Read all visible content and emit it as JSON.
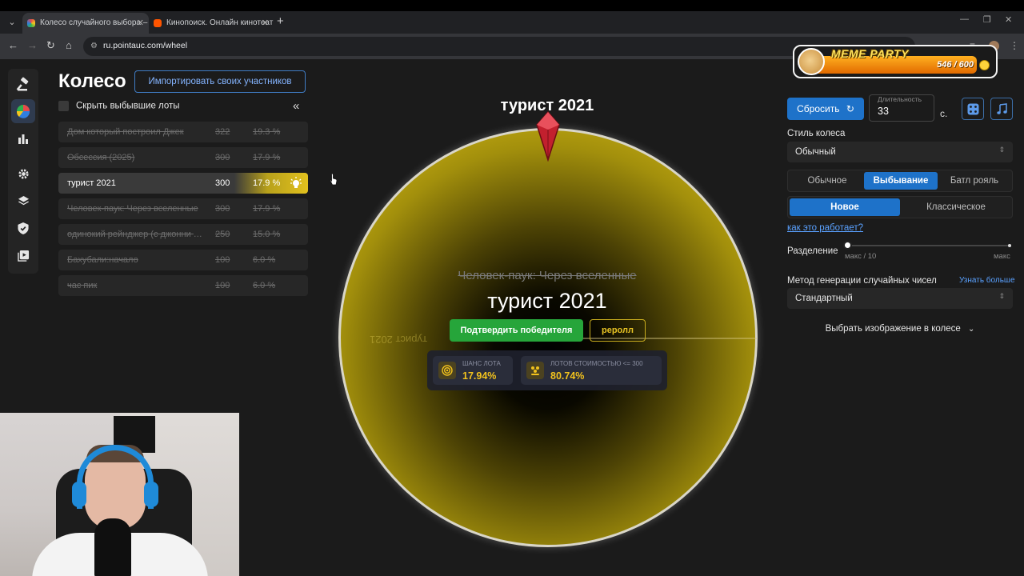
{
  "browser": {
    "tabs": [
      {
        "title": "Колесо случайного выбора – П",
        "active": true
      },
      {
        "title": "Кинопоиск. Онлайн кинотеатр",
        "active": false
      }
    ],
    "url": "ru.pointauc.com/wheel"
  },
  "header": {
    "title": "Колесо",
    "import_label": "Импортировать своих участников"
  },
  "filters": {
    "hide_eliminated_label": "Скрыть выбывшие лоты"
  },
  "lots": [
    {
      "name": "Дом который построил Джек",
      "amount": "322",
      "percent": "19.3 %",
      "eliminated": true
    },
    {
      "name": "Обсессия (2025)",
      "amount": "300",
      "percent": "17.9 %",
      "eliminated": true
    },
    {
      "name": "турист 2021",
      "amount": "300",
      "percent": "17.9 %",
      "eliminated": false
    },
    {
      "name": "Человек-паук: Через вселенные",
      "amount": "300",
      "percent": "17.9 %",
      "eliminated": true
    },
    {
      "name": "одинокий рейнджер (с джонни депом)",
      "amount": "250",
      "percent": "15.0 %",
      "eliminated": true
    },
    {
      "name": "Бахубали:начало",
      "amount": "100",
      "percent": "6.0 %",
      "eliminated": true
    },
    {
      "name": "час пик",
      "amount": "100",
      "percent": "6.0 %",
      "eliminated": true
    }
  ],
  "wheel": {
    "title": "турист 2021",
    "mirrored_label": "турист 2021",
    "previous_winner": "Человек-паук: Через вселенные",
    "winner": "турист 2021",
    "confirm_label": "Подтвердить победителя",
    "reroll_label": "реролл",
    "stats": [
      {
        "label": "ШАНС ЛОТА",
        "value": "17.94%"
      },
      {
        "label": "ЛОТОВ СТОИМОСТЬЮ <= 300",
        "value": "80.74%"
      }
    ],
    "color": "#c6ad12"
  },
  "controls": {
    "reset_label": "Сбросить",
    "duration_label": "Длительность",
    "duration_value": "33",
    "duration_unit": "с.",
    "wheel_style_label": "Стиль колеса",
    "wheel_style_value": "Обычный",
    "modes": [
      "Обычное",
      "Выбывание",
      "Батл рояль"
    ],
    "active_mode": "Выбывание",
    "submodes": [
      "Новое",
      "Классическое"
    ],
    "active_submode": "Новое",
    "how_label": "как это работает?",
    "split_label": "Разделение",
    "split_min": "макс / 10",
    "split_max": "макс",
    "split_position": 0,
    "rng_label": "Метод генерации случайных чисел",
    "learn_more": "Узнать больше",
    "rng_value": "Стандартный",
    "choose_image": "Выбрать изображение в колесе"
  },
  "overlay": {
    "meme_title": "MEME PARTY",
    "meme_count": "546 / 600",
    "meme_progress": 0.91
  }
}
